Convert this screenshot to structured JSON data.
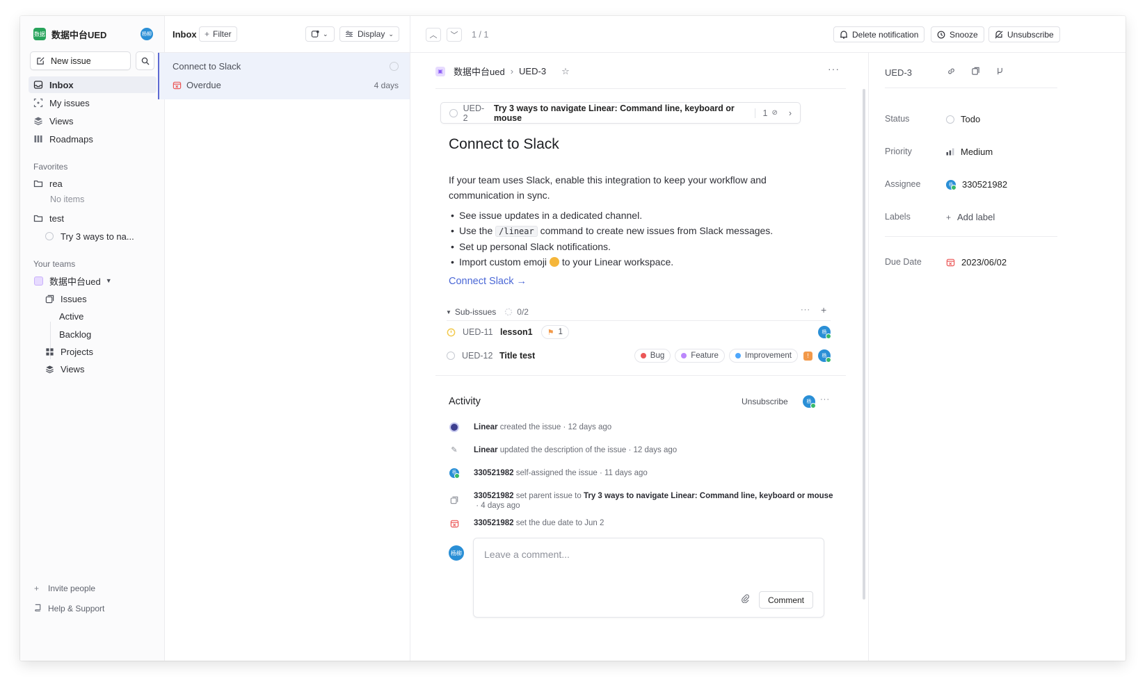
{
  "workspace": {
    "name": "数据中台UED",
    "logo_text": "数据",
    "avatar_text": "杨柳"
  },
  "sidebar": {
    "new_issue_label": "New issue",
    "nav": [
      {
        "label": "Inbox",
        "icon": "inbox-icon"
      },
      {
        "label": "My issues",
        "icon": "target-icon"
      },
      {
        "label": "Views",
        "icon": "layers-icon"
      },
      {
        "label": "Roadmaps",
        "icon": "map-icon"
      }
    ],
    "favorites_label": "Favorites",
    "favorites": [
      {
        "label": "rea",
        "empty_text": "No items"
      },
      {
        "label": "test",
        "child": "Try 3 ways to na..."
      }
    ],
    "teams_label": "Your teams",
    "team": {
      "name": "数据中台ued",
      "items": [
        "Issues",
        "Active",
        "Backlog",
        "Projects",
        "Views"
      ]
    },
    "invite_label": "Invite people",
    "help_label": "Help & Support"
  },
  "inbox": {
    "title": "Inbox",
    "filter_label": "Filter",
    "display_label": "Display",
    "notification": {
      "title": "Connect to Slack",
      "reason": "Overdue",
      "age": "4 days"
    }
  },
  "topbar": {
    "pager": "1 / 1",
    "delete_label": "Delete notification",
    "snooze_label": "Snooze",
    "unsubscribe_label": "Unsubscribe"
  },
  "issue": {
    "team": "数据中台ued",
    "id": "UED-3",
    "parent": {
      "id": "UED-2",
      "title": "Try 3 ways to navigate Linear: Command line, keyboard or mouse",
      "count": "1"
    },
    "title": "Connect to Slack",
    "description": "If your team uses Slack, enable this integration to keep your workflow and communication in sync.",
    "bullets": {
      "b1": "See issue updates in a dedicated channel.",
      "b2_pre": "Use the",
      "b2_code": "/linear",
      "b2_post": "command to create new issues from Slack messages.",
      "b3": "Set up personal Slack notifications.",
      "b4_pre": "Import custom emoji",
      "b4_post": "to your Linear workspace."
    },
    "link": "Connect Slack →",
    "sub_issues_label": "Sub-issues",
    "sub_issues_progress": "0/2",
    "sub_issues": [
      {
        "id": "UED-11",
        "title": "lesson1",
        "flag_count": "1"
      },
      {
        "id": "UED-12",
        "title": "Title test",
        "labels": [
          {
            "name": "Bug",
            "color": "#eb5757"
          },
          {
            "name": "Feature",
            "color": "#bb87fc"
          },
          {
            "name": "Improvement",
            "color": "#4ea7fc"
          }
        ]
      }
    ]
  },
  "activity": {
    "title": "Activity",
    "unsubscribe_label": "Unsubscribe",
    "events": [
      {
        "actor": "Linear",
        "text": "created the issue · 12 days ago"
      },
      {
        "actor": "Linear",
        "text": "updated the description of the issue · 12 days ago"
      },
      {
        "actor": "330521982",
        "text": "self-assigned the issue · 11 days ago"
      },
      {
        "actor": "330521982",
        "text": "set parent issue to",
        "target": "Try 3 ways to navigate Linear: Command line, keyboard or mouse",
        "time": "· 4 days ago"
      },
      {
        "actor": "330521982",
        "text": "set the due date to Jun 2"
      }
    ],
    "comment_placeholder": "Leave a comment...",
    "comment_label": "Comment"
  },
  "properties": {
    "id": "UED-3",
    "status_label": "Status",
    "status_value": "Todo",
    "priority_label": "Priority",
    "priority_value": "Medium",
    "assignee_label": "Assignee",
    "assignee_value": "330521982",
    "labels_label": "Labels",
    "labels_value": "Add label",
    "due_label": "Due Date",
    "due_value": "2023/06/02"
  },
  "colors": {
    "accent": "#5e6ad2",
    "link": "#4a67d6",
    "overdue": "#eb5757",
    "team": "#8b5cf6"
  }
}
